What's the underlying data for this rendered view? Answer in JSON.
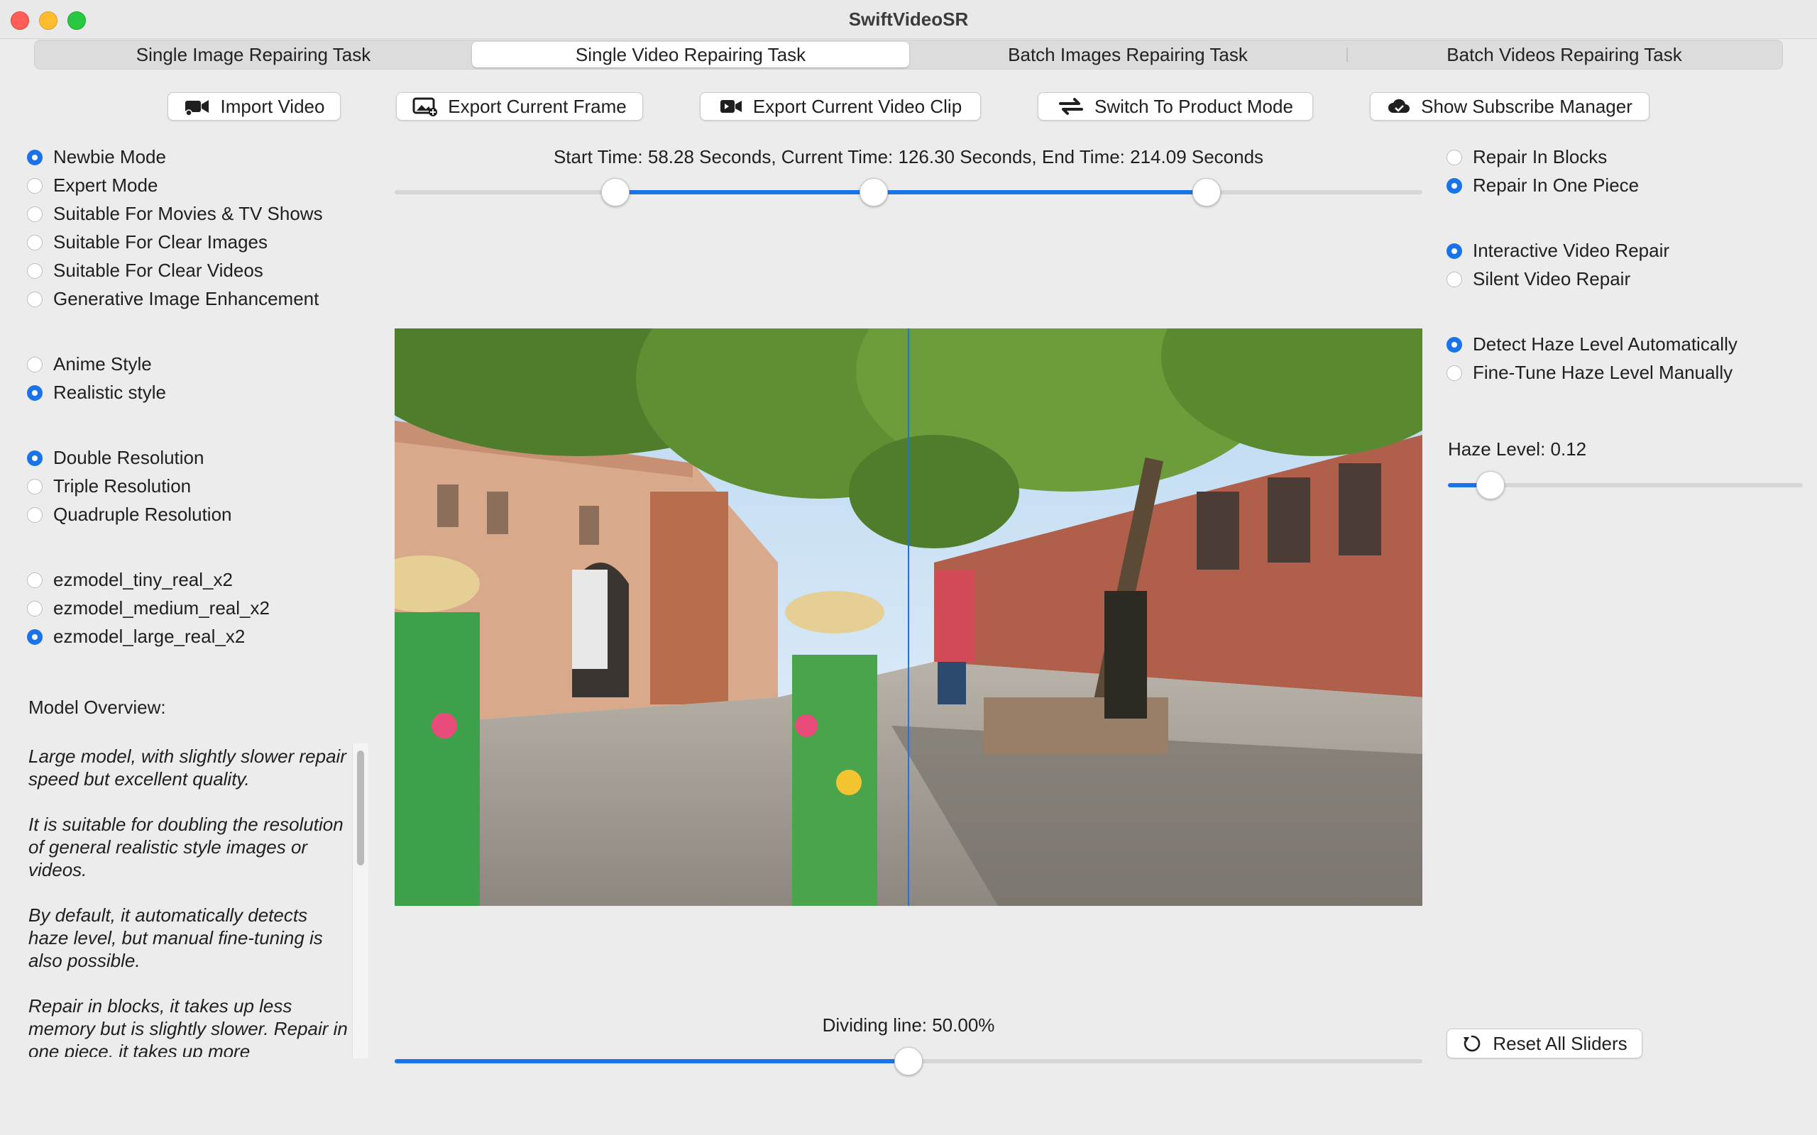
{
  "window": {
    "title": "SwiftVideoSR"
  },
  "tabs": [
    {
      "label": "Single Image Repairing Task",
      "active": false
    },
    {
      "label": "Single Video Repairing Task",
      "active": true
    },
    {
      "label": "Batch Images Repairing Task",
      "active": false
    },
    {
      "label": "Batch Videos Repairing Task",
      "active": false
    }
  ],
  "toolbar": {
    "import_video": {
      "label": "Import Video",
      "icon": "video-camera-icon"
    },
    "export_frame": {
      "label": "Export Current Frame",
      "icon": "image-export-icon"
    },
    "export_clip": {
      "label": "Export Current Video Clip",
      "icon": "video-clip-icon"
    },
    "product_mode": {
      "label": "Switch To Product Mode",
      "icon": "swap-icon"
    },
    "subscribe": {
      "label": "Show Subscribe Manager",
      "icon": "cloud-check-icon"
    }
  },
  "mode_options": [
    {
      "label": "Newbie Mode",
      "selected": true
    },
    {
      "label": "Expert Mode",
      "selected": false
    },
    {
      "label": "Suitable For Movies & TV Shows",
      "selected": false
    },
    {
      "label": "Suitable For Clear Images",
      "selected": false
    },
    {
      "label": "Suitable For Clear Videos",
      "selected": false
    },
    {
      "label": "Generative Image Enhancement",
      "selected": false
    }
  ],
  "style_options": [
    {
      "label": "Anime Style",
      "selected": false
    },
    {
      "label": "Realistic style",
      "selected": true
    }
  ],
  "resolution_options": [
    {
      "label": "Double Resolution",
      "selected": true
    },
    {
      "label": "Triple Resolution",
      "selected": false
    },
    {
      "label": "Quadruple Resolution",
      "selected": false
    }
  ],
  "model_options": [
    {
      "label": "ezmodel_tiny_real_x2",
      "selected": false
    },
    {
      "label": "ezmodel_medium_real_x2",
      "selected": false
    },
    {
      "label": "ezmodel_large_real_x2",
      "selected": true
    }
  ],
  "overview": {
    "title": "Model Overview:",
    "paragraphs": [
      "Large model, with slightly slower repair speed but excellent quality.",
      "It is suitable for doubling the resolution of general realistic style images or videos.",
      "By default, it automatically detects haze level, but manual fine-tuning is also possible.",
      "Repair in blocks, it takes up less memory but is slightly slower. Repair in one piece, it takes up more"
    ]
  },
  "timeline": {
    "status": "Start Time: 58.28 Seconds, Current Time: 126.30 Seconds, End Time: 214.09 Seconds",
    "start_fraction": 0.215,
    "current_fraction": 0.466,
    "end_fraction": 0.79
  },
  "divider": {
    "label": "Dividing line: 50.00%",
    "fraction": 0.5
  },
  "repair_split_options": [
    {
      "label": "Repair In Blocks",
      "selected": false
    },
    {
      "label": "Repair In One Piece",
      "selected": true
    }
  ],
  "repair_interaction_options": [
    {
      "label": "Interactive Video Repair",
      "selected": true
    },
    {
      "label": "Silent Video Repair",
      "selected": false
    }
  ],
  "haze_options": [
    {
      "label": "Detect Haze Level Automatically",
      "selected": true
    },
    {
      "label": "Fine-Tune Haze Level Manually",
      "selected": false
    }
  ],
  "haze": {
    "label": "Haze Level: 0.12",
    "fraction": 0.12
  },
  "reset_button": {
    "label": "Reset All Sliders",
    "icon": "reset-icon"
  },
  "colors": {
    "accent": "#1a73e8",
    "window_bg": "#ececec"
  }
}
